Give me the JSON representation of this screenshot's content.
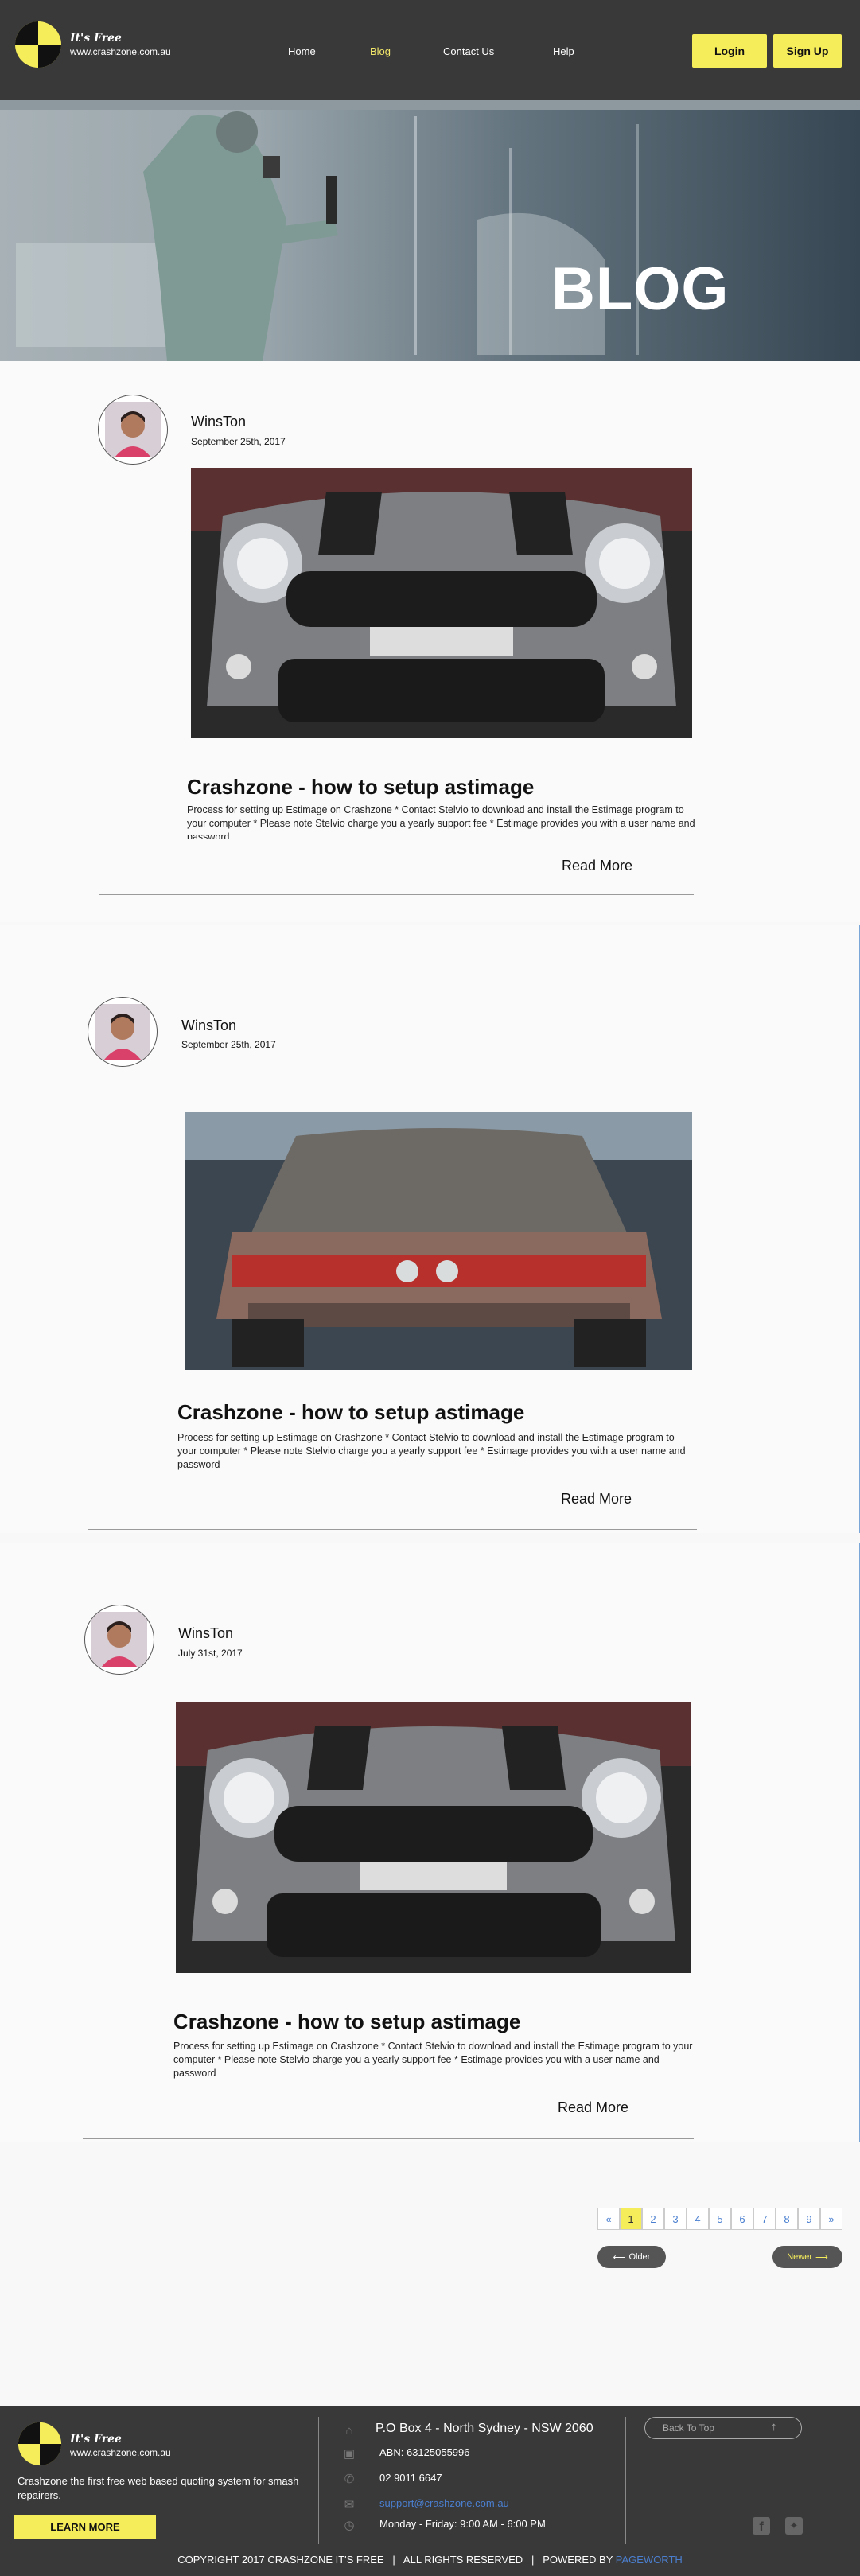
{
  "header": {
    "logo_line1": "It's Free",
    "logo_line2": "www.crashzone.com.au",
    "nav": [
      "Home",
      "Blog",
      "Contact Us",
      "Help"
    ],
    "login": "Login",
    "signup": "Sign Up"
  },
  "hero": {
    "title": "BLOG"
  },
  "posts": [
    {
      "author": "WinsTon",
      "date": "September 25th, 2017",
      "title": "Crashzone - how to setup astimage",
      "text": "Process for setting up Estimage on Crashzone * Contact Stelvio to download and install the Estimage program to your computer * Please note Stelvio charge you a yearly support fee * Estimage provides you with a user name and password",
      "read_more": "Read More"
    },
    {
      "author": "WinsTon",
      "date": "September 25th, 2017",
      "title": "Crashzone - how to setup astimage",
      "text": "Process for setting up Estimage on Crashzone * Contact Stelvio to download and install the Estimage program to your computer * Please note Stelvio charge you a yearly support fee * Estimage provides you with a user name and password",
      "read_more": "Read More"
    },
    {
      "author": "WinsTon",
      "date": "July 31st, 2017",
      "title": "Crashzone - how to setup astimage",
      "text": "Process for setting up Estimage on Crashzone * Contact Stelvio to download and install the Estimage program to your computer * Please note Stelvio charge you a yearly support fee * Estimage provides you with a user name and password",
      "read_more": "Read More"
    }
  ],
  "pagination": {
    "prev": "«",
    "pages": [
      "1",
      "2",
      "3",
      "4",
      "5",
      "6",
      "7",
      "8",
      "9"
    ],
    "next": "»",
    "active_page": "1",
    "older": "Older",
    "newer": "Newer"
  },
  "footer": {
    "logo_line1": "It's Free",
    "logo_line2": "www.crashzone.com.au",
    "tagline": "Crashzone the first free web based quoting system for smash repairers.",
    "learn_more": "LEARN MORE",
    "address": "P.O Box 4 - North Sydney - NSW 2060",
    "abn": "ABN: 63125055996",
    "phone": "02 9011 6647",
    "email": "support@crashzone.com.au",
    "hours": "Monday - Friday: 9:00 AM - 6:00 PM",
    "back_to_top": "Back To Top",
    "copyright": "COPYRIGHT 2017 CRASHZONE IT'S FREE   |   ALL RIGHTS RESERVED   |   POWERED BY",
    "powered_by": "PAGEWORTH"
  },
  "colors": {
    "accent": "#f6ed5b",
    "dark": "#3a3939",
    "link": "#4a7fd0"
  }
}
